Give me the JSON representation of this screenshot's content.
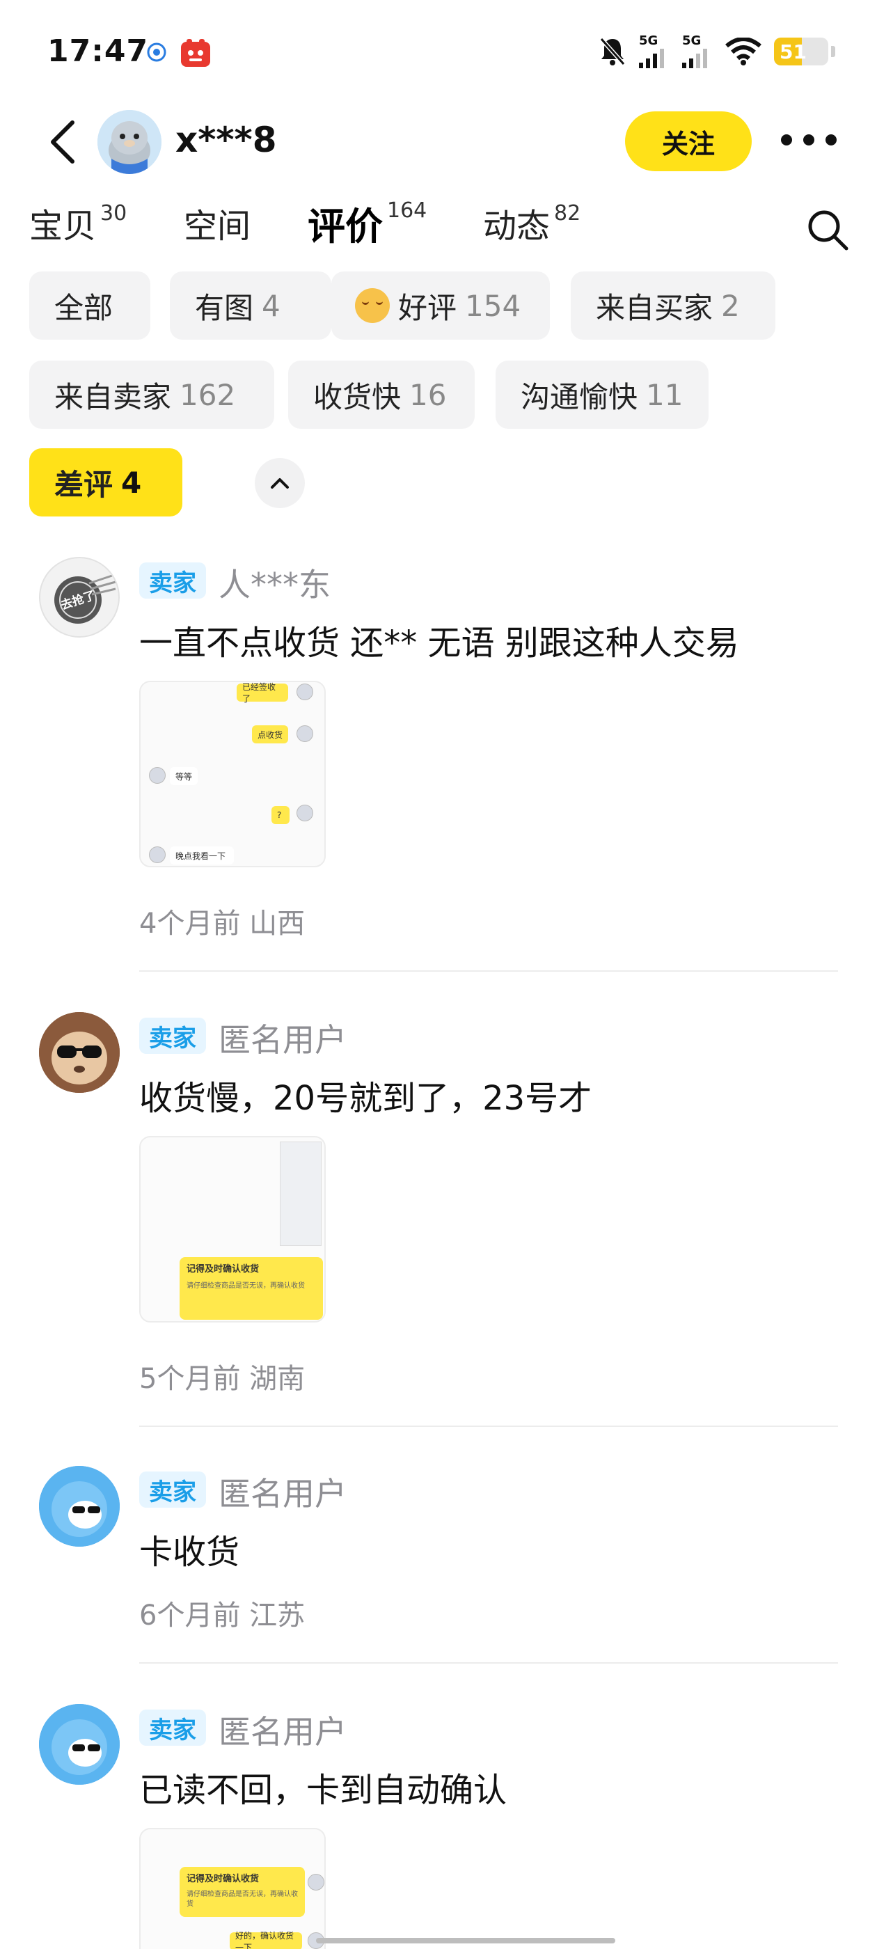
{
  "status_bar": {
    "time": "17:47",
    "battery": "51",
    "battery_level_percent": 51,
    "net1": "5G",
    "net2": "5G"
  },
  "header": {
    "username": "x***8",
    "follow_label": "关注"
  },
  "tabs": [
    {
      "label": "宝贝",
      "count": "30"
    },
    {
      "label": "空间",
      "count": ""
    },
    {
      "label": "评价",
      "count": "164"
    },
    {
      "label": "动态",
      "count": "82"
    }
  ],
  "filters": [
    {
      "label": "全部",
      "count": ""
    },
    {
      "label": "有图",
      "count": "4"
    },
    {
      "label": "好评",
      "count": "154"
    },
    {
      "label": "来自买家",
      "count": "2"
    },
    {
      "label": "来自卖家",
      "count": "162"
    },
    {
      "label": "收货快",
      "count": "16"
    },
    {
      "label": "沟通愉快",
      "count": "11"
    },
    {
      "label": "差评",
      "count": "4"
    }
  ],
  "reviews": [
    {
      "badge": "卖家",
      "name": "人***东",
      "text": "一直不点收货 还** 无语 别跟这种人交易",
      "meta": "4个月前  山西",
      "avatar_label": "去抢了",
      "image_bubbles": [
        "已经签收了",
        "点收货",
        "等等",
        "?",
        "晚点我看一下"
      ]
    },
    {
      "badge": "卖家",
      "name": "匿名用户",
      "text": "收货慢，20号就到了，23号才",
      "meta": "5个月前  湖南",
      "image_card_title": "记得及时确认收货",
      "image_card_body": "请仔细检查商品是否无误，再确认收货"
    },
    {
      "badge": "卖家",
      "name": "匿名用户",
      "text": "卡收货",
      "meta": "6个月前  江苏"
    },
    {
      "badge": "卖家",
      "name": "匿名用户",
      "text": "已读不回，卡到自动确认",
      "image_card_title": "记得及时确认收货",
      "image_card_body": "请仔细检查商品是否无误，再确认收货",
      "image_bubble": "好的，确认收货一下"
    }
  ],
  "colors": {
    "accent": "#ffe118",
    "badge_bg": "#e6f5ff",
    "badge_text": "#1a9ee8",
    "muted": "#8e8e93"
  }
}
